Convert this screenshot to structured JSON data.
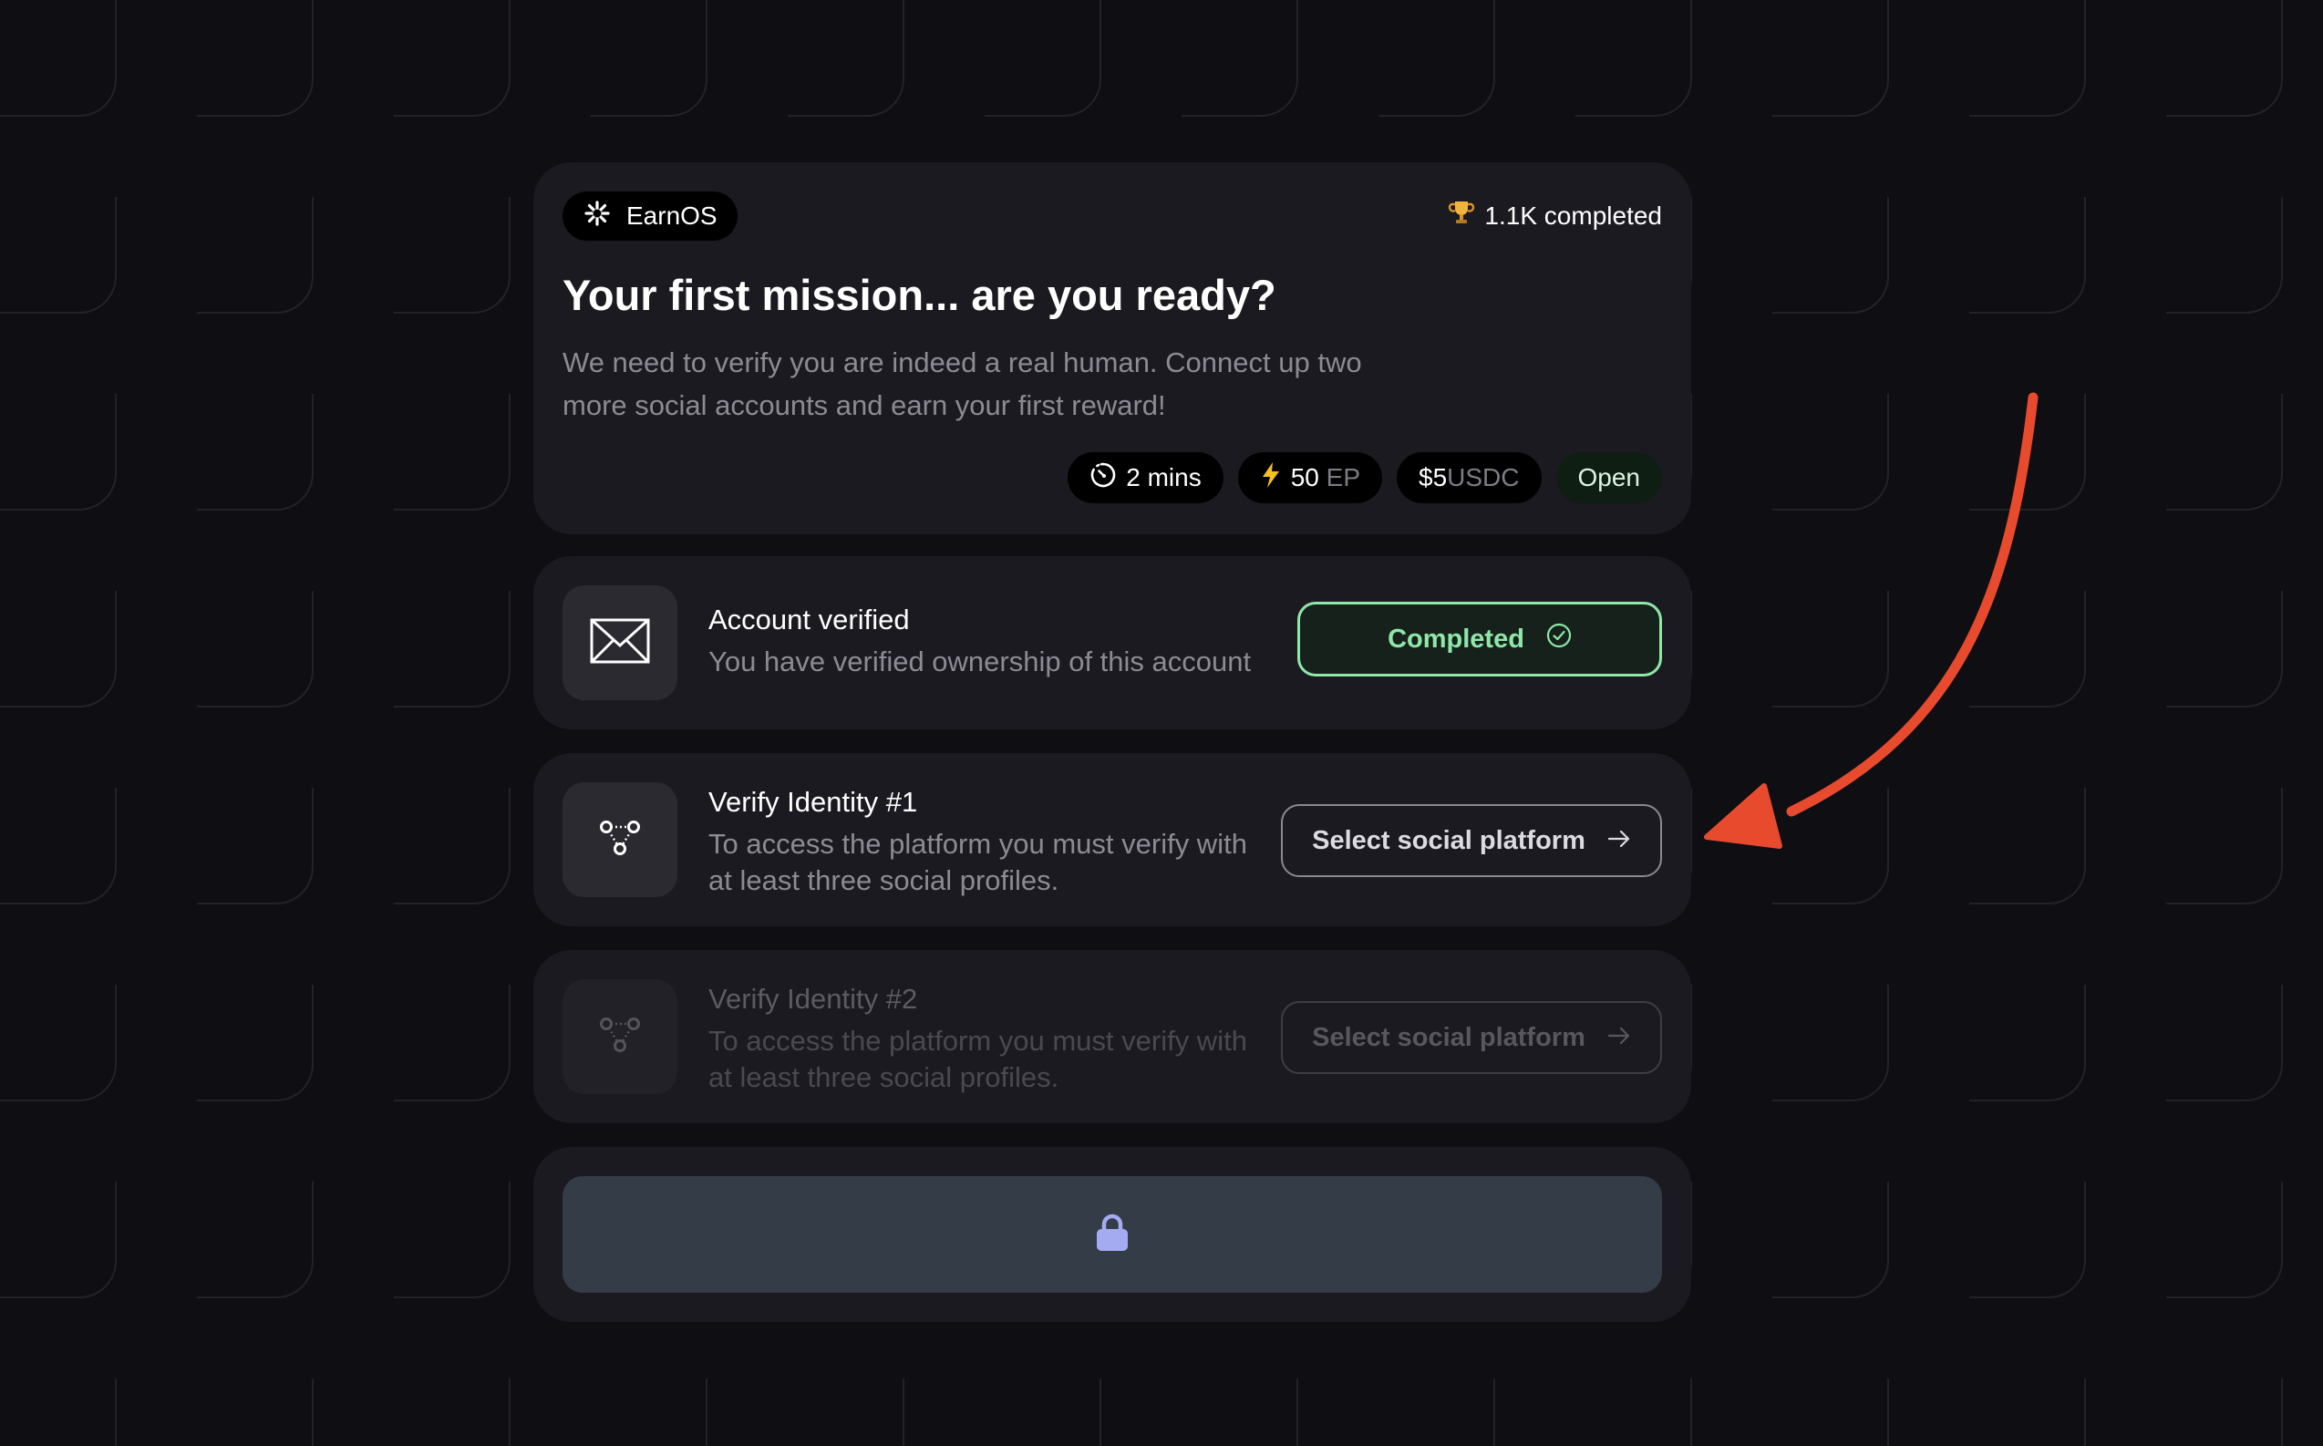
{
  "hero": {
    "brand": "EarnOS",
    "brand_icon": "sparkle-icon",
    "completed_count": "1.1K completed",
    "completed_icon": "trophy-icon",
    "title": "Your first mission... are you ready?",
    "description": "We need to verify you are indeed a real human. Connect up two more social accounts and earn your first reward!",
    "chips": {
      "time": "2 mins",
      "ep_value": "50",
      "ep_unit": "EP",
      "usdc_value": "$5",
      "usdc_unit": "USDC",
      "status": "Open"
    }
  },
  "steps": [
    {
      "title": "Account verified",
      "subtitle": "You have verified ownership of this account",
      "icon": "envelope-icon",
      "button": "Completed",
      "button_icon": "check-circle-icon"
    },
    {
      "title": "Verify Identity #1",
      "subtitle": "To access the platform you must verify with at least three social profiles.",
      "icon": "network-icon",
      "button": "Select social platform",
      "button_icon": "arrow-right-icon"
    },
    {
      "title": "Verify Identity #2",
      "subtitle": "To access the platform you must verify with at least three social profiles.",
      "icon": "network-icon",
      "button": "Select social platform",
      "button_icon": "arrow-right-icon",
      "disabled": true
    }
  ],
  "lock": {
    "icon": "lock-icon"
  },
  "colors": {
    "background": "#0e0e13",
    "card": "#1b1a21",
    "success": "#8fe7a8",
    "lock_button": "#343c47",
    "lock_icon": "#a5abf0",
    "annotation_arrow": "#e84a2e"
  }
}
